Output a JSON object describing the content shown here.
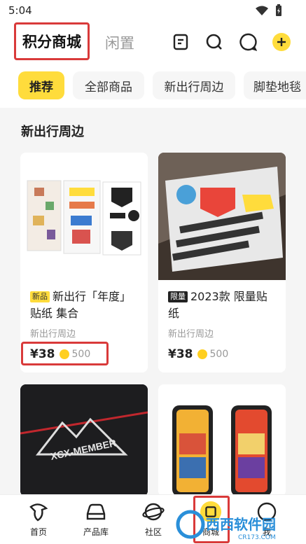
{
  "status": {
    "time": "5:04"
  },
  "header": {
    "tabs": [
      "积分商城",
      "闲置"
    ],
    "icons": [
      "list-icon",
      "search-icon",
      "chat-icon",
      "add-icon"
    ]
  },
  "chips": [
    "推荐",
    "全部商品",
    "新出行周边",
    "脚垫地毯"
  ],
  "section": {
    "title": "新出行周边"
  },
  "products": [
    {
      "tag": "新品",
      "title": "新出行「年度」贴纸 集合",
      "category": "新出行周边",
      "price": "¥38",
      "points": "500"
    },
    {
      "tag": "限量",
      "title": "2023款 限量贴纸",
      "category": "新出行周边",
      "price": "¥38",
      "points": "500"
    }
  ],
  "product_images": {
    "card3_text": "XCX-MEMBER"
  },
  "nav": [
    {
      "label": "首页",
      "icon": "home-icon"
    },
    {
      "label": "产品库",
      "icon": "car-icon"
    },
    {
      "label": "社区",
      "icon": "planet-icon"
    },
    {
      "label": "商城",
      "icon": "shop-icon"
    },
    {
      "label": "我",
      "icon": "profile-icon"
    }
  ],
  "watermark": {
    "text": "西西软件园",
    "sub": "CR173.COM"
  },
  "colors": {
    "accent": "#ffdc3c",
    "highlight": "#d93a3a"
  }
}
